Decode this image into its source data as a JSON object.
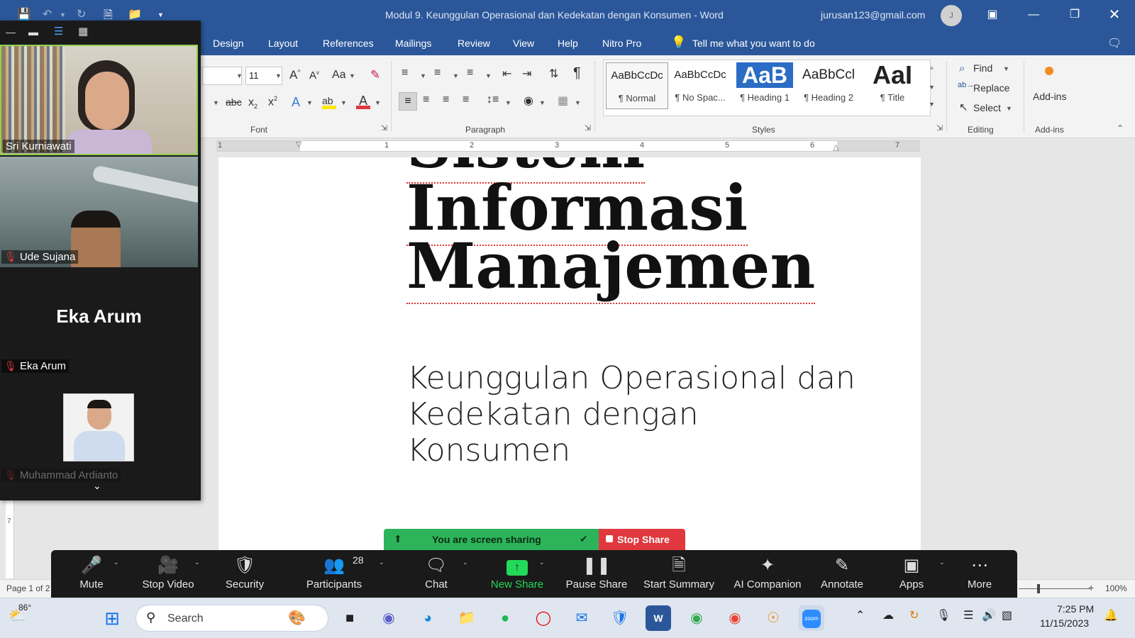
{
  "titlebar": {
    "title": "Modul 9. Keunggulan Operasional dan Kedekatan dengan Konsumen  -  Word",
    "account": "jurusan123@gmail.com",
    "avatar_letter": "J"
  },
  "menu": [
    "Design",
    "Layout",
    "References",
    "Mailings",
    "Review",
    "View",
    "Help",
    "Nitro Pro"
  ],
  "tell_me": "Tell me what you want to do",
  "ribbon": {
    "font": {
      "name": "",
      "size": "11",
      "label": "Font",
      "case_btn": "Aa"
    },
    "paragraph": {
      "label": "Paragraph"
    },
    "styles": {
      "label": "Styles",
      "items": [
        {
          "preview": "AaBbCcDc",
          "name": "¶ Normal"
        },
        {
          "preview": "AaBbCcDc",
          "name": "¶ No Spac..."
        },
        {
          "preview": "AaB",
          "name": "¶ Heading 1"
        },
        {
          "preview": "AaBbCcl",
          "name": "¶ Heading 2"
        },
        {
          "preview": "AaI",
          "name": "¶ Title"
        }
      ]
    },
    "editing": {
      "label": "Editing",
      "find": "Find",
      "replace": "Replace",
      "select": "Select"
    },
    "addins": {
      "label": "Add-ins",
      "button": "Add-ins"
    }
  },
  "ruler": {
    "ticks": [
      "1",
      "1",
      "2",
      "3",
      "4",
      "5",
      "6",
      "7"
    ]
  },
  "document": {
    "title_lines": [
      "Sistem",
      "Informasi",
      "Manajemen"
    ],
    "subtitle_lines": [
      "Keunggulan Operasional dan",
      "Kedekatan dengan",
      "Konsumen"
    ]
  },
  "statusbar": {
    "page": "Page 1 of 2",
    "zoom": "100%"
  },
  "gallery": {
    "participants": [
      {
        "name": "Sri Kurniawati",
        "muted": false
      },
      {
        "name": "Ude Sujana",
        "muted": true
      },
      {
        "name": "Eka Arum",
        "muted": true,
        "display": "Eka Arum"
      },
      {
        "name": "Muhammad Ardianto",
        "muted": true
      }
    ]
  },
  "sharebar": {
    "text": "You are screen sharing",
    "stop": "Stop Share"
  },
  "zoom_toolbar": {
    "participants_count": "28",
    "buttons": [
      "Mute",
      "Stop Video",
      "Security",
      "Participants",
      "Chat",
      "New Share",
      "Pause Share",
      "Start Summary",
      "AI Companion",
      "Annotate",
      "Apps",
      "More"
    ]
  },
  "taskbar": {
    "weather": "86°",
    "search_placeholder": "Search",
    "time": "7:25 PM",
    "date": "11/15/2023"
  },
  "colors": {
    "word_blue": "#2b579a",
    "share_green": "#2db45b",
    "stop_red": "#e0383e",
    "zoom_dark": "#1a1a1a",
    "new_share_green": "#23d959"
  }
}
